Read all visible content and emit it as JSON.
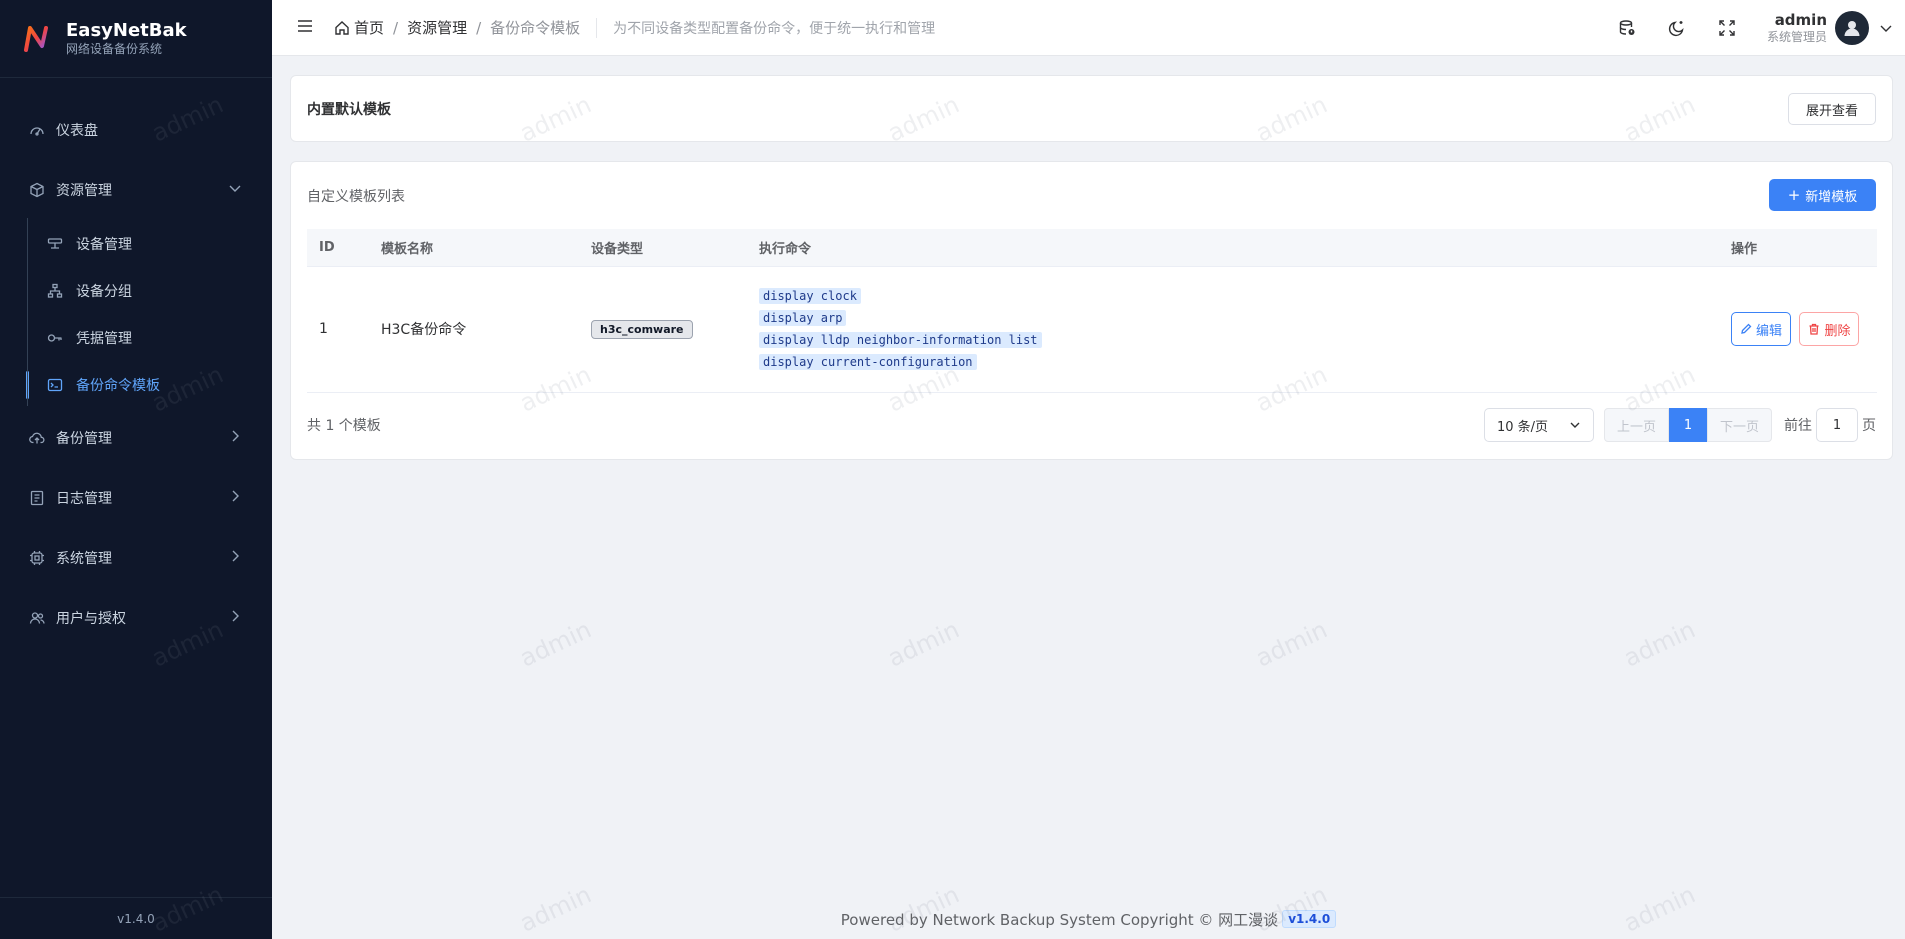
{
  "brand": {
    "name": "EasyNetBak",
    "subtitle": "网络设备备份系统"
  },
  "sidebar": {
    "items": [
      {
        "label": "仪表盘",
        "icon": "dashboard-icon"
      },
      {
        "label": "资源管理",
        "icon": "box-icon",
        "expanded": true,
        "children": [
          {
            "label": "设备管理",
            "icon": "server-icon"
          },
          {
            "label": "设备分组",
            "icon": "sitemap-icon"
          },
          {
            "label": "凭据管理",
            "icon": "key-icon"
          },
          {
            "label": "备份命令模板",
            "icon": "terminal-icon",
            "active": true
          }
        ]
      },
      {
        "label": "备份管理",
        "icon": "cloud-upload-icon"
      },
      {
        "label": "日志管理",
        "icon": "log-icon"
      },
      {
        "label": "系统管理",
        "icon": "cpu-icon"
      },
      {
        "label": "用户与授权",
        "icon": "users-icon"
      }
    ],
    "version": "v1.4.0"
  },
  "header": {
    "breadcrumb": [
      "首页",
      "资源管理",
      "备份命令模板"
    ],
    "description": "为不同设备类型配置备份命令，便于统一执行和管理",
    "user": {
      "name": "admin",
      "role": "系统管理员"
    }
  },
  "builtin_card": {
    "title": "内置默认模板",
    "expand_label": "展开查看"
  },
  "custom_card": {
    "title": "自定义模板列表",
    "add_label": "新增模板",
    "columns": [
      "ID",
      "模板名称",
      "设备类型",
      "执行命令",
      "操作"
    ],
    "rows": [
      {
        "id": "1",
        "name": "H3C备份命令",
        "device_type": "h3c_comware",
        "commands": [
          "display clock",
          "display arp",
          "display lldp neighbor-information list",
          "display current-configuration"
        ],
        "edit_label": "编辑",
        "delete_label": "删除"
      }
    ],
    "total_text": "共 1 个模板",
    "pagination": {
      "page_size": "10 条/页",
      "prev": "上一页",
      "current": "1",
      "next": "下一页",
      "goto_prefix": "前往",
      "goto_value": "1",
      "goto_suffix": "页"
    }
  },
  "footer": {
    "text": "Powered by Network Backup System Copyright © 网工漫谈",
    "version": "v1.4.0"
  },
  "watermark": "admin",
  "colors": {
    "primary": "#3b82f6",
    "sidebar_bg": "#0f172a",
    "danger": "#ef4444"
  }
}
